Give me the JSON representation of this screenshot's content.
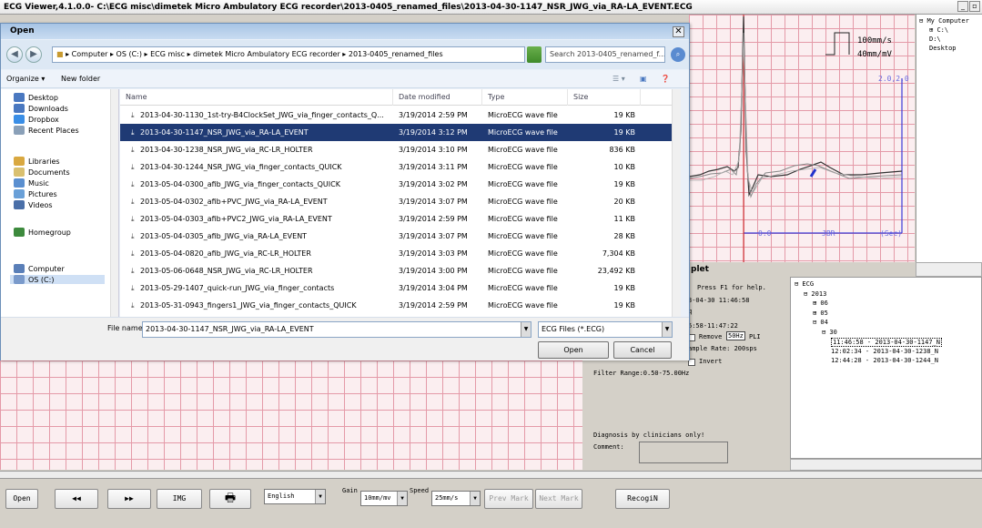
{
  "app": {
    "title": "ECG Viewer,4.1.0.0- C:\\ECG misc\\dimetek Micro Ambulatory ECG recorder\\2013-0405_renamed_files\\2013-04-30-1147_NSR_JWG_via_RA-LA_EVENT.ECG",
    "min_label": "_",
    "max_label": "▫",
    "close_label": "✕"
  },
  "dialog": {
    "title": "Open",
    "close_label": "✕",
    "breadcrumb": "▸ Computer ▸ OS (C:) ▸ ECG misc ▸ dimetek Micro Ambulatory ECG recorder ▸ 2013-0405_renamed_files",
    "search_placeholder": "Search 2013-0405_renamed_f...",
    "toolbar": {
      "organize": "Organize ▾",
      "new_folder": "New folder"
    },
    "nav": [
      {
        "label": "Desktop",
        "color": "#4a78c0"
      },
      {
        "label": "Downloads",
        "color": "#4a78c0"
      },
      {
        "label": "Dropbox",
        "color": "#3a8ee6"
      },
      {
        "label": "Recent Places",
        "color": "#8aa0b8"
      },
      {
        "label": "Libraries",
        "color": "#d9a840"
      },
      {
        "label": "Documents",
        "color": "#d9c070"
      },
      {
        "label": "Music",
        "color": "#5a8fd0"
      },
      {
        "label": "Pictures",
        "color": "#6aa0d8"
      },
      {
        "label": "Videos",
        "color": "#4a6fa8"
      },
      {
        "label": "Homegroup",
        "color": "#3d8a3d"
      },
      {
        "label": "Computer",
        "color": "#5a7fb8"
      },
      {
        "label": "OS (C:)",
        "color": "#7a9acb"
      }
    ],
    "columns": {
      "name": "Name",
      "date": "Date modified",
      "type": "Type",
      "size": "Size"
    },
    "files": [
      {
        "name": "2013-04-30-1130_1st-try-B4ClockSet_JWG_via_finger_contacts_Q...",
        "date": "3/19/2014 2:59 PM",
        "type": "MicroECG wave file",
        "size": "19 KB"
      },
      {
        "name": "2013-04-30-1147_NSR_JWG_via_RA-LA_EVENT",
        "date": "3/19/2014 3:12 PM",
        "type": "MicroECG wave file",
        "size": "19 KB"
      },
      {
        "name": "2013-04-30-1238_NSR_JWG_via_RC-LR_HOLTER",
        "date": "3/19/2014 3:10 PM",
        "type": "MicroECG wave file",
        "size": "836 KB"
      },
      {
        "name": "2013-04-30-1244_NSR_JWG_via_finger_contacts_QUICK",
        "date": "3/19/2014 3:11 PM",
        "type": "MicroECG wave file",
        "size": "10 KB"
      },
      {
        "name": "2013-05-04-0300_afib_JWG_via_finger_contacts_QUICK",
        "date": "3/19/2014 3:02 PM",
        "type": "MicroECG wave file",
        "size": "19 KB"
      },
      {
        "name": "2013-05-04-0302_afib+PVC_JWG_via_RA-LA_EVENT",
        "date": "3/19/2014 3:07 PM",
        "type": "MicroECG wave file",
        "size": "20 KB"
      },
      {
        "name": "2013-05-04-0303_afib+PVC2_JWG_via_RA-LA_EVENT",
        "date": "3/19/2014 2:59 PM",
        "type": "MicroECG wave file",
        "size": "11 KB"
      },
      {
        "name": "2013-05-04-0305_afib_JWG_via_RA-LA_EVENT",
        "date": "3/19/2014 3:07 PM",
        "type": "MicroECG wave file",
        "size": "28 KB"
      },
      {
        "name": "2013-05-04-0820_afib_JWG_via_RC-LR_HOLTER",
        "date": "3/19/2014 3:03 PM",
        "type": "MicroECG wave file",
        "size": "7,304 KB"
      },
      {
        "name": "2013-05-06-0648_NSR_JWG_via_RC-LR_HOLTER",
        "date": "3/19/2014 3:00 PM",
        "type": "MicroECG wave file",
        "size": "23,492 KB"
      },
      {
        "name": "2013-05-29-1407_quick-run_JWG_via_finger_contacts",
        "date": "3/19/2014 3:04 PM",
        "type": "MicroECG wave file",
        "size": "19 KB"
      },
      {
        "name": "2013-05-31-0943_fingers1_JWG_via_finger_contacts_QUICK",
        "date": "3/19/2014 2:59 PM",
        "type": "MicroECG wave file",
        "size": "19 KB"
      },
      {
        "name": "2013-05-31-0944_fingers2_JWG_via_finger_contacts_QUICK",
        "date": "3/19/2014 2:59 PM",
        "type": "MicroECG wave file",
        "size": "19 KB"
      }
    ],
    "filename_label": "File name:",
    "filename_value": "2013-04-30-1147_NSR_JWG_via_RA-LA_EVENT",
    "filetype_value": "ECG Files (*.ECG)",
    "open_label": "Open",
    "cancel_label": "Cancel"
  },
  "ecg": {
    "speed_label": "100mm/s",
    "gain_label": "40mm/mV",
    "scale_top": "2.0,2.0",
    "axis_start": "0.0",
    "axis_mid": "JBR",
    "axis_unit": "(Sec)",
    "panel_title": "plet"
  },
  "tree_top": [
    "My Computer",
    "C:\\",
    "D:\\",
    "Desktop"
  ],
  "info": {
    "help": "Press F1 for help.",
    "date": "3-04-30 11:46:58",
    "q": "q",
    "range": "6:58-11:47:22",
    "remove": "Remove",
    "remove_hz": "50Hz",
    "pli": "PLI",
    "sample": "ample Rate: 200sps",
    "invert": "Invert",
    "filter": "Filter Range:0.50-75.00Hz",
    "diag": "Diagnosis by clinicians only!",
    "comment": "Comment:"
  },
  "tree2": [
    {
      "text": "⊟ ECG",
      "indent": 0
    },
    {
      "text": "⊟ 2013",
      "indent": 1
    },
    {
      "text": "⊞ 06",
      "indent": 2
    },
    {
      "text": "⊞ 05",
      "indent": 2
    },
    {
      "text": "⊟ 04",
      "indent": 2
    },
    {
      "text": "⊟ 30",
      "indent": 3
    },
    {
      "text": "11:46:58 - 2013-04-30-1147_N",
      "indent": 4,
      "selected": true
    },
    {
      "text": "12:02:34 - 2013-04-30-1238_N",
      "indent": 4
    },
    {
      "text": "12:44:28 - 2013-04-30-1244_N",
      "indent": 4
    }
  ],
  "bottom": {
    "open": "Open",
    "prev": "◀◀",
    "next": "▶▶",
    "img": "IMG",
    "print_icon": "printer-icon",
    "language": "English",
    "gain_label": "Gain",
    "gain_value": "10mm/mv",
    "speed_label": "Speed",
    "speed_value": "25mm/s",
    "prev_mark": "Prev Mark",
    "next_mark": "Next Mark",
    "recog": "RecogiN"
  },
  "colors": {
    "selection": "#1f3a74",
    "grid": "#e49aa8",
    "grid_bg": "#fbeef0",
    "axis": "#3b3bd8"
  }
}
